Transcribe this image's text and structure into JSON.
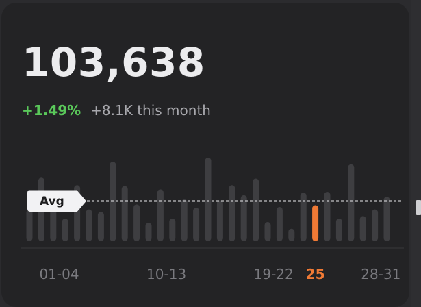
{
  "card": {
    "total": "103,638",
    "change_pct": "+1.49%",
    "change_sub": "+8.1K this month"
  },
  "avg_label": "Avg",
  "colors": {
    "bar": "#3e3e41",
    "highlight": "#f07a35",
    "positive": "#5ac85a",
    "avg_line": "#e8e8ea"
  },
  "chart_data": {
    "type": "bar",
    "categories": [
      "1",
      "2",
      "3",
      "4",
      "5",
      "6",
      "7",
      "8",
      "9",
      "10",
      "11",
      "12",
      "13",
      "14",
      "15",
      "16",
      "17",
      "18",
      "19",
      "20",
      "21",
      "22",
      "23",
      "24",
      "25",
      "26",
      "27",
      "28",
      "29",
      "30",
      "31"
    ],
    "values": [
      0.38,
      0.76,
      0.52,
      0.27,
      0.67,
      0.38,
      0.35,
      0.95,
      0.66,
      0.44,
      0.22,
      0.62,
      0.27,
      0.5,
      0.4,
      1.0,
      0.49,
      0.67,
      0.55,
      0.75,
      0.23,
      0.41,
      0.15,
      0.58,
      0.43,
      0.59,
      0.27,
      0.92,
      0.3,
      0.38,
      0.53
    ],
    "highlight_index": 24,
    "avg": 0.48,
    "x_labels": [
      {
        "text": "01-04",
        "at": 2.5
      },
      {
        "text": "10-13",
        "at": 11.5
      },
      {
        "text": "19-22",
        "at": 20.5
      },
      {
        "text": "25",
        "at": 24,
        "highlight": true
      },
      {
        "text": "28-31",
        "at": 29.5
      }
    ]
  }
}
